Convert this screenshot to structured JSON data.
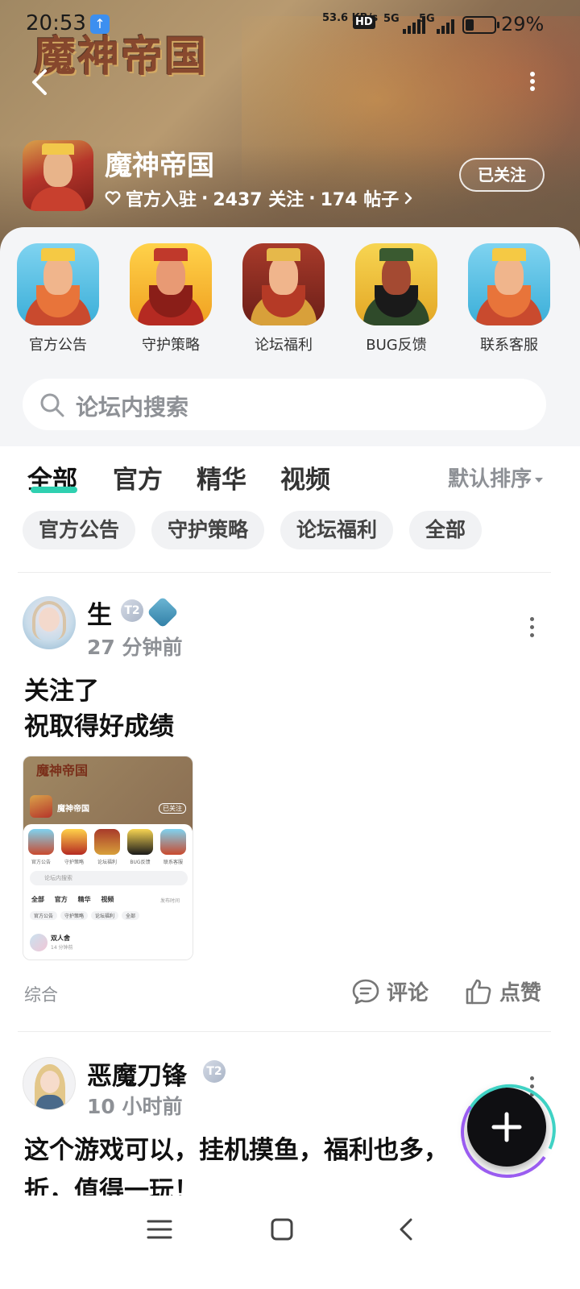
{
  "status_bar": {
    "time": "20:53",
    "network_speed": "53.6 KB/s",
    "hd_label": "HD",
    "signal_1": "5G",
    "signal_2": "5G",
    "battery": "29%"
  },
  "header": {
    "game_logo_text": "魔神帝国",
    "forum_name": "魔神帝国",
    "meta": {
      "official": "官方入驻",
      "followers": "2437 关注",
      "posts": "174 帖子",
      "separator": "·"
    },
    "follow_button": "已关注"
  },
  "shortcuts": [
    {
      "label": "官方公告",
      "icon": "king-portrait-icon"
    },
    {
      "label": "守护策略",
      "icon": "warrior-portrait-icon"
    },
    {
      "label": "论坛福利",
      "icon": "general-portrait-icon"
    },
    {
      "label": "BUG反馈",
      "icon": "guan-yu-portrait-icon"
    },
    {
      "label": "联系客服",
      "icon": "king-portrait-icon"
    }
  ],
  "search": {
    "placeholder": "论坛内搜索"
  },
  "tabs": [
    "全部",
    "官方",
    "精华",
    "视频"
  ],
  "sort_label": "默认排序",
  "chips": [
    "官方公告",
    "守护策略",
    "论坛福利",
    "全部"
  ],
  "posts": [
    {
      "author": "生",
      "badge": "T2",
      "time": "27 分钟前",
      "lines": [
        "关注了",
        "祝取得好成绩"
      ],
      "tag": "综合",
      "comment_label": "评论",
      "like_label": "点赞",
      "thumbnail": {
        "logo": "魔神帝国",
        "forum_name": "魔神帝国",
        "follow": "已关注",
        "shortcut_labels": [
          "官方公告",
          "守护策略",
          "论坛福利",
          "BUG反馈",
          "联系客服"
        ],
        "search": "论坛内搜索",
        "tabs": "全部 官方 精华 视频",
        "sort": "发布时间",
        "chips": [
          "官方公告",
          "守护策略",
          "论坛福利",
          "全部"
        ],
        "user": "双人舍",
        "user_time": "14 分钟前"
      }
    },
    {
      "author": "恶魔刀锋",
      "badge": "T2",
      "time": "10 小时前",
      "lines": [
        "这个游戏可以，挂机摸鱼，福利也多，",
        "折，值得一玩！"
      ]
    }
  ],
  "colors": {
    "accent": "#2fd0b0",
    "muted_text": "#8e9196",
    "panel_bg": "#f4f5f7"
  }
}
